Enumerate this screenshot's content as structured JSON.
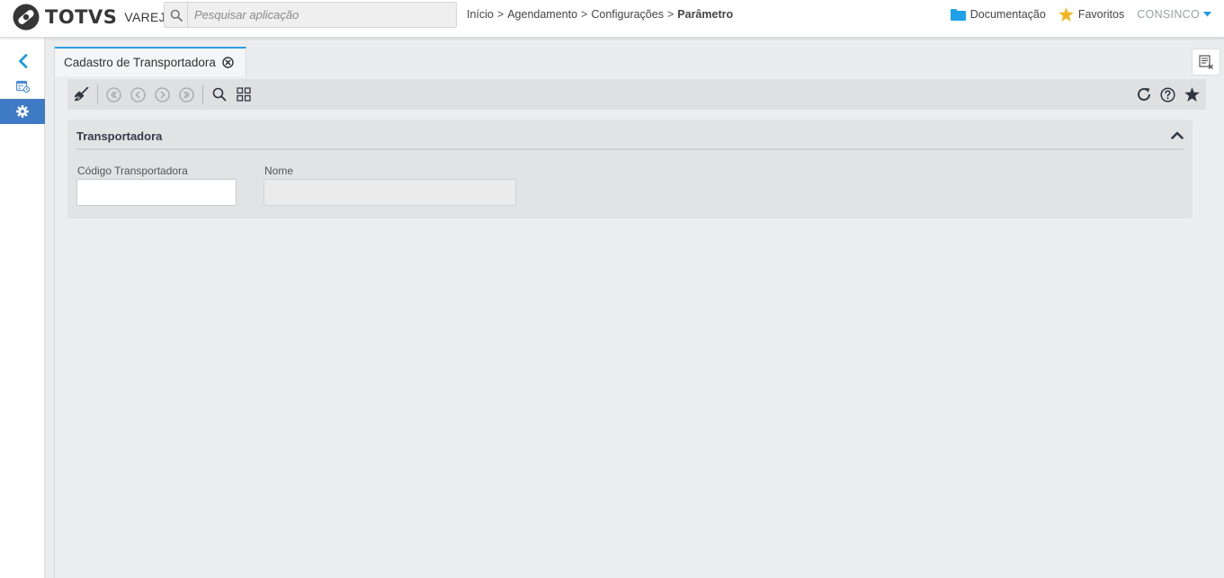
{
  "header": {
    "brand": "TOTVS",
    "product": "VAREJO",
    "search": {
      "placeholder": "Pesquisar aplicação",
      "value": ""
    },
    "breadcrumb": [
      "Início",
      "Agendamento",
      "Configurações",
      "Parâmetro"
    ],
    "breadcrumb_separator": ">",
    "documentation_label": "Documentação",
    "favorites_label": "Favoritos",
    "user_label": "CONSINCO"
  },
  "sidebar": {
    "items": [
      {
        "icon": "chevron-left-icon"
      },
      {
        "icon": "calendar-icon"
      },
      {
        "icon": "gear-icon",
        "active": true
      }
    ]
  },
  "tabs": [
    {
      "label": "Cadastro de Transportadora",
      "active": true
    }
  ],
  "toolbar": {
    "left_icons": [
      "broom-icon",
      "first-record-icon",
      "previous-record-icon",
      "next-record-icon",
      "last-record-icon",
      "search-icon",
      "grid-icon"
    ],
    "right_icons": [
      "refresh-icon",
      "help-icon",
      "star-icon"
    ]
  },
  "form": {
    "section_title": "Transportadora",
    "fields": [
      {
        "label": "Código Transportadora",
        "value": ""
      },
      {
        "label": "Nome",
        "value": ""
      }
    ]
  },
  "colors": {
    "accent_blue": "#2b9ee6",
    "sidebar_active": "#3f7ac4",
    "favorites_star": "#f2b522",
    "folder_blue": "#1ea1e8"
  }
}
